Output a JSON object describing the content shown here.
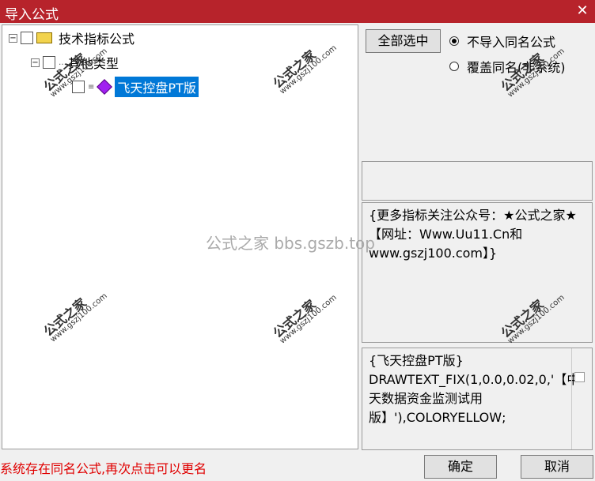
{
  "window": {
    "title": "导入公式",
    "close_glyph": "✕"
  },
  "tree": {
    "items": [
      {
        "label": "技术指标公式"
      },
      {
        "label": "其他类型"
      },
      {
        "label": "飞天控盘PT版"
      }
    ]
  },
  "right": {
    "select_all": "全部选中",
    "radio_no_import": "不导入同名公式",
    "radio_overwrite": "覆盖同名(非系统)",
    "description": "{更多指标关注公众号：★公式之家★ 【网址：Www.Uu11.Cn和www.gszj100.com】}",
    "code": "{飞天控盘PT版}\nDRAWTEXT_FIX(1,0.0,0.02,0,'【中天数据资金监测试用版】'),COLORYELLOW;"
  },
  "footer": {
    "status": "系统存在同名公式,再次点击可以更名",
    "ok": "确定",
    "cancel": "取消"
  },
  "watermark": {
    "big": "公式之家",
    "small": "www.gszj100.com",
    "center": "公式之家 bbs.gszb.top"
  }
}
